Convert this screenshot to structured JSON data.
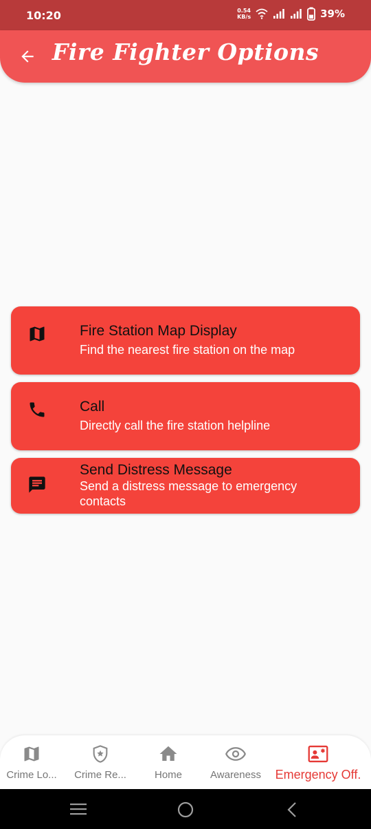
{
  "status": {
    "time": "10:20",
    "speed_value": "0.54",
    "speed_unit": "KB/s",
    "battery": "39%"
  },
  "appbar": {
    "title": "Fire Fighter Options",
    "back_icon": "arrow-back-icon"
  },
  "options": [
    {
      "icon": "map-icon",
      "title": "Fire Station Map Display",
      "subtitle": "Find the nearest fire station on the map"
    },
    {
      "icon": "phone-icon",
      "title": "Call",
      "subtitle": "Directly call the fire station helpline"
    },
    {
      "icon": "message-icon",
      "title": "Send Distress Message",
      "subtitle": "Send a distress message to emergency contacts"
    }
  ],
  "bottom_nav": {
    "items": [
      {
        "label": "Crime Lo...",
        "icon": "map-icon"
      },
      {
        "label": "Crime Re...",
        "icon": "shield-star-icon"
      },
      {
        "label": "Home",
        "icon": "home-icon"
      },
      {
        "label": "Awareness",
        "icon": "eye-icon"
      },
      {
        "label": "Emergency Off.",
        "icon": "contact-emergency-icon",
        "active": true
      }
    ]
  },
  "colors": {
    "status_bar": "#b83a3a",
    "app_bar": "#f05454",
    "card": "#f4433b",
    "active_nav": "#e53935",
    "inactive_nav": "#757575"
  }
}
